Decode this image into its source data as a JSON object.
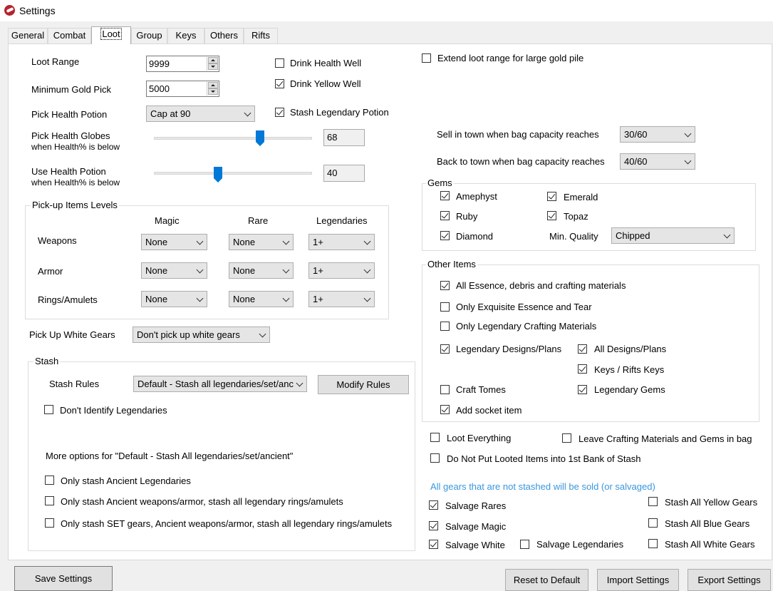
{
  "window": {
    "title": "Settings"
  },
  "tabs": [
    "General",
    "Combat",
    "Loot",
    "Group",
    "Keys",
    "Others",
    "Rifts"
  ],
  "loot": {
    "loot_range": {
      "label": "Loot Range",
      "value": "9999"
    },
    "min_gold": {
      "label": "Minimum Gold Pick",
      "value": "5000"
    },
    "health_potion": {
      "label": "Pick Health Potion",
      "value": "Cap at 90"
    },
    "health_globes": {
      "label1": "Pick Health Globes",
      "label2": "when Health% is below",
      "value": "68",
      "level": 68
    },
    "use_potion": {
      "label1": "Use Health Potion",
      "label2": "when Health% is below",
      "value": "40",
      "level": 40
    },
    "drink_health_well": {
      "label": "Drink Health Well",
      "checked": false
    },
    "drink_yellow_well": {
      "label": "Drink Yellow Well",
      "checked": true
    },
    "stash_legendary_potion": {
      "label": "Stash Legendary Potion",
      "checked": true
    },
    "extend_loot_range": {
      "label": "Extend loot range for large gold pile",
      "checked": false
    }
  },
  "levels": {
    "title": "Pick-up Items Levels",
    "columns": [
      "Magic",
      "Rare",
      "Legendaries"
    ],
    "rows": [
      {
        "label": "Weapons",
        "values": [
          "None",
          "None",
          "1+"
        ]
      },
      {
        "label": "Armor",
        "values": [
          "None",
          "None",
          "1+"
        ]
      },
      {
        "label": "Rings/Amulets",
        "values": [
          "None",
          "None",
          "1+"
        ]
      }
    ]
  },
  "white_gears": {
    "label": "Pick Up White Gears",
    "value": "Don't pick up white gears"
  },
  "stash": {
    "title": "Stash",
    "rules_label": "Stash Rules",
    "rules_value": "Default - Stash all legendaries/set/ancient",
    "modify_button": "Modify Rules",
    "dont_identify": {
      "label": "Don't Identify Legendaries",
      "checked": false
    },
    "more_options": "More options for \"Default - Stash All legendaries/set/ancient\"",
    "opt_ancient": {
      "label": "Only stash Ancient Legendaries",
      "checked": false
    },
    "opt_ancient_weapons": {
      "label": "Only stash Ancient weapons/armor, stash all legendary rings/amulets",
      "checked": false
    },
    "opt_set": {
      "label": "Only stash SET gears, Ancient weapons/armor, stash all legendary rings/amulets",
      "checked": false
    }
  },
  "town": {
    "sell_label": "Sell in town when bag capacity reaches",
    "sell_value": "30/60",
    "back_label": "Back to town when bag capacity reaches",
    "back_value": "40/60"
  },
  "gems": {
    "title": "Gems",
    "amephyst": {
      "label": "Amephyst",
      "checked": true
    },
    "emerald": {
      "label": "Emerald",
      "checked": true
    },
    "ruby": {
      "label": "Ruby",
      "checked": true
    },
    "topaz": {
      "label": "Topaz",
      "checked": true
    },
    "diamond": {
      "label": "Diamond",
      "checked": true
    },
    "quality_label": "Min. Quality",
    "quality_value": "Chipped"
  },
  "other": {
    "title": "Other Items",
    "essence": {
      "label": "All Essence, debris and crafting materials",
      "checked": true
    },
    "exquisite": {
      "label": "Only Exquisite Essence and Tear",
      "checked": false
    },
    "legendary_crafting": {
      "label": "Only Legendary Crafting Materials",
      "checked": false
    },
    "legendary_designs": {
      "label": "Legendary Designs/Plans",
      "checked": true
    },
    "all_designs": {
      "label": "All Designs/Plans",
      "checked": true
    },
    "keys": {
      "label": "Keys / Rifts Keys",
      "checked": true
    },
    "craft_tomes": {
      "label": "Craft Tomes",
      "checked": false
    },
    "legendary_gems": {
      "label": "Legendary Gems",
      "checked": true
    },
    "socket_item": {
      "label": "Add socket item",
      "checked": true
    }
  },
  "misc": {
    "loot_everything": {
      "label": "Loot Everything",
      "checked": false
    },
    "leave_crafting": {
      "label": "Leave Crafting Materials and Gems in bag",
      "checked": false
    },
    "no_first_bank": {
      "label": "Do Not Put Looted Items into 1st Bank of Stash",
      "checked": false
    },
    "note": "All gears that are not stashed will be sold (or salvaged)",
    "salvage_rares": {
      "label": "Salvage Rares",
      "checked": true
    },
    "salvage_magic": {
      "label": "Salvage Magic",
      "checked": true
    },
    "salvage_white": {
      "label": "Salvage White",
      "checked": true
    },
    "salvage_legendaries": {
      "label": "Salvage Legendaries",
      "checked": false
    },
    "stash_yellow": {
      "label": "Stash All Yellow Gears",
      "checked": false
    },
    "stash_blue": {
      "label": "Stash All Blue Gears",
      "checked": false
    },
    "stash_white": {
      "label": "Stash All White Gears",
      "checked": false
    }
  },
  "footer": {
    "save": "Save Settings",
    "reset": "Reset to Default",
    "import": "Import Settings",
    "export": "Export Settings"
  },
  "colors": {
    "accent": "#0078d7",
    "note": "#3a96dd"
  }
}
